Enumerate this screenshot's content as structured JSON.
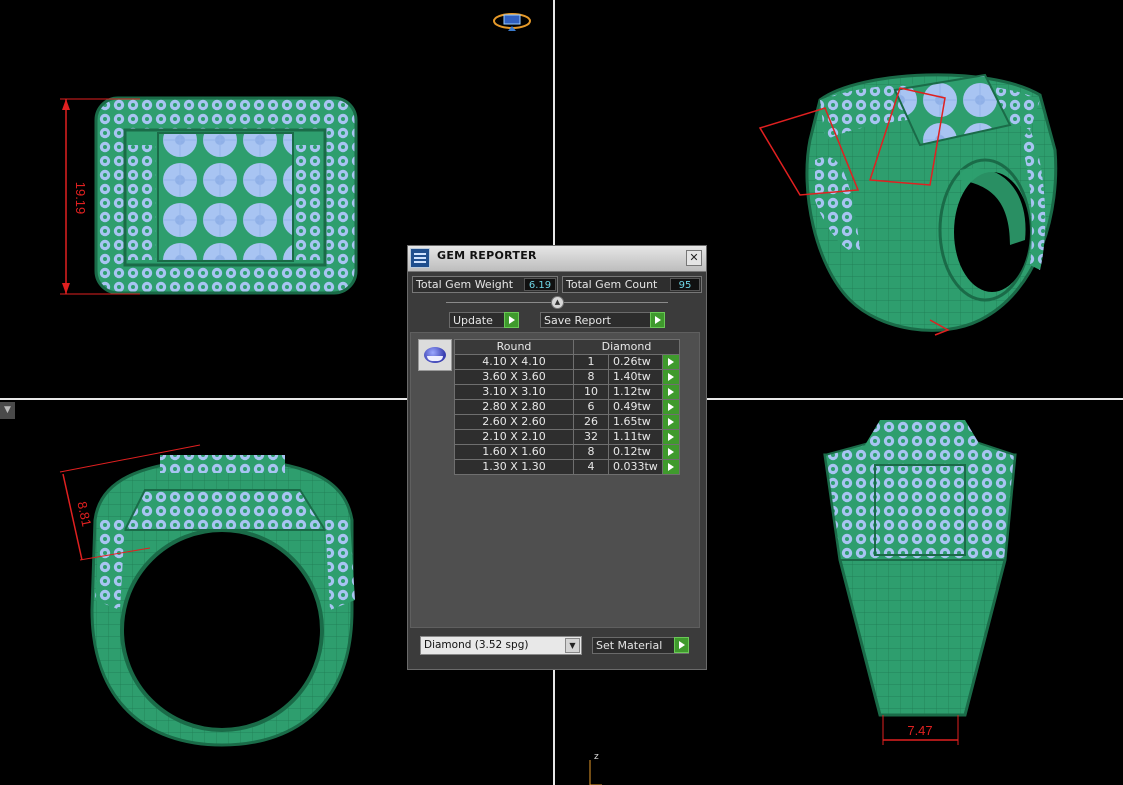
{
  "viewports": {
    "top_view_dimension": "19.19",
    "front_view_dimension": "8.81",
    "side_view_dimension": "7.47",
    "axis_label": "z"
  },
  "gem_reporter": {
    "title": "GEM REPORTER",
    "close_glyph": "✕",
    "total_weight_label": "Total Gem Weight",
    "total_weight_value": "6.19",
    "total_count_label": "Total Gem Count",
    "total_count_value": "95",
    "update_label": "Update",
    "save_report_label": "Save Report",
    "table_headers": {
      "shape": "Round",
      "material": "Diamond"
    },
    "rows": [
      {
        "size": "4.10 X 4.10",
        "count": "1",
        "weight": "0.26tw"
      },
      {
        "size": "3.60 X 3.60",
        "count": "8",
        "weight": "1.40tw"
      },
      {
        "size": "3.10 X 3.10",
        "count": "10",
        "weight": "1.12tw"
      },
      {
        "size": "2.80 X 2.80",
        "count": "6",
        "weight": "0.49tw"
      },
      {
        "size": "2.60 X 2.60",
        "count": "26",
        "weight": "1.65tw"
      },
      {
        "size": "2.10 X 2.10",
        "count": "32",
        "weight": "1.11tw"
      },
      {
        "size": "1.60 X 1.60",
        "count": "8",
        "weight": "0.12tw"
      },
      {
        "size": "1.30 X 1.30",
        "count": "4",
        "weight": "0.033tw"
      }
    ],
    "material_select_value": "Diamond    (3.52 spg)",
    "set_material_label": "Set Material"
  },
  "colors": {
    "metal": "#2e9e6e",
    "metal_line": "#1a6b48",
    "gem": "#a8c4f2",
    "dimension": "#e02020",
    "background": "#000000"
  }
}
